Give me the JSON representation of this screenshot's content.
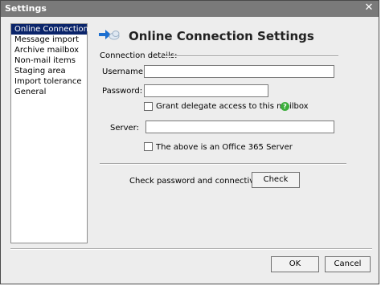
{
  "window": {
    "title": "Settings",
    "close_glyph": "✕"
  },
  "sidebar": {
    "items": [
      {
        "label": "Online Connection",
        "selected": true
      },
      {
        "label": "Message import"
      },
      {
        "label": "Archive mailbox"
      },
      {
        "label": "Non-mail items"
      },
      {
        "label": "Staging area"
      },
      {
        "label": "Import tolerance"
      },
      {
        "label": "General"
      }
    ]
  },
  "header": {
    "title": "Online Connection Settings",
    "icon": "arrow-cloud-icon"
  },
  "connection": {
    "section_label": "Connection details:",
    "username_label": "Username:",
    "username_value": "",
    "password_label": "Password:",
    "password_value": "",
    "delegate_label": "Grant delegate access to this mailbox",
    "delegate_checked": false,
    "server_label": "Server:",
    "server_value": "",
    "office365_label": "The above is an Office 365 Server",
    "office365_checked": false
  },
  "check": {
    "label": "Check password and connectivity:",
    "button": "Check"
  },
  "footer": {
    "ok": "OK",
    "cancel": "Cancel"
  },
  "colors": {
    "selection": "#0a246a",
    "help": "#3cae3c",
    "titlebar": "#7a7a7a"
  }
}
